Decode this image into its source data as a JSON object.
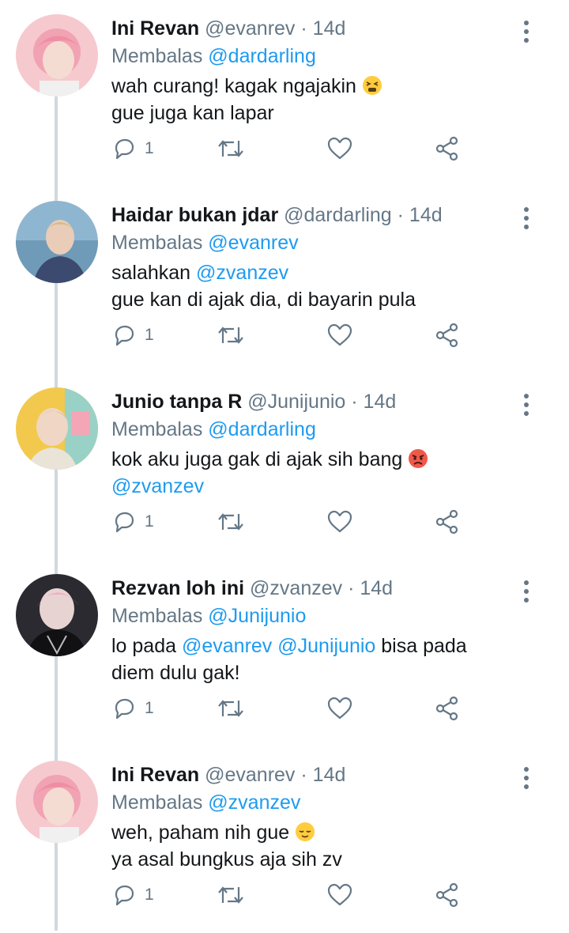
{
  "labels": {
    "reply_prefix": "Membalas",
    "dot": "·"
  },
  "colors": {
    "accent": "#1d9bf0",
    "muted": "#657786",
    "text": "#14171a",
    "thread_line": "#cfd9de"
  },
  "tweets": [
    {
      "name": "Ini Revan",
      "handle": "@evanrev",
      "time": "14d",
      "replying_to": "@dardarling",
      "avatar": "pink-hair-portrait",
      "line1": [
        "wah curang! kagak ngajakin"
      ],
      "line1_emoji": "tired-face-emoji",
      "line2": "gue juga kan lapar",
      "reply_count": "1"
    },
    {
      "name": "Haidar bukan jdar",
      "handle": "@dardarling",
      "time": "14d",
      "replying_to": "@evanrev",
      "avatar": "beach-portrait",
      "line1_prefix": "salahkan",
      "line1_mention": "@zvanzev",
      "line2": "gue kan di ajak dia, di bayarin pula",
      "reply_count": "1"
    },
    {
      "name": "Junio tanpa R",
      "handle": "@Junijunio",
      "time": "14d",
      "replying_to": "@dardarling",
      "avatar": "bright-room-portrait",
      "line1": "kok aku juga gak di ajak sih bang",
      "line1_emoji": "angry-face-emoji",
      "line2_mention": "@zvanzev",
      "reply_count": "1"
    },
    {
      "name": "Rezvan loh ini",
      "handle": "@zvanzev",
      "time": "14d",
      "replying_to": "@Junijunio",
      "avatar": "dark-jacket-portrait",
      "line1_prefix": "lo pada",
      "line1_mention_a": "@evanrev",
      "line1_mention_b": "@Junijunio",
      "line1_suffix": "bisa pada",
      "line2": "diem dulu gak!",
      "reply_count": "1"
    },
    {
      "name": "Ini Revan",
      "handle": "@evanrev",
      "time": "14d",
      "replying_to": "@zvanzev",
      "avatar": "pink-hair-portrait",
      "line1": "weh, paham nih gue",
      "line1_emoji": "relieved-face-emoji",
      "line2": "ya asal bungkus aja sih zv",
      "reply_count": "1"
    }
  ],
  "icons": {
    "reply": "reply-icon",
    "retweet": "retweet-icon",
    "like": "heart-icon",
    "share": "share-icon",
    "more": "more-vertical-icon"
  }
}
